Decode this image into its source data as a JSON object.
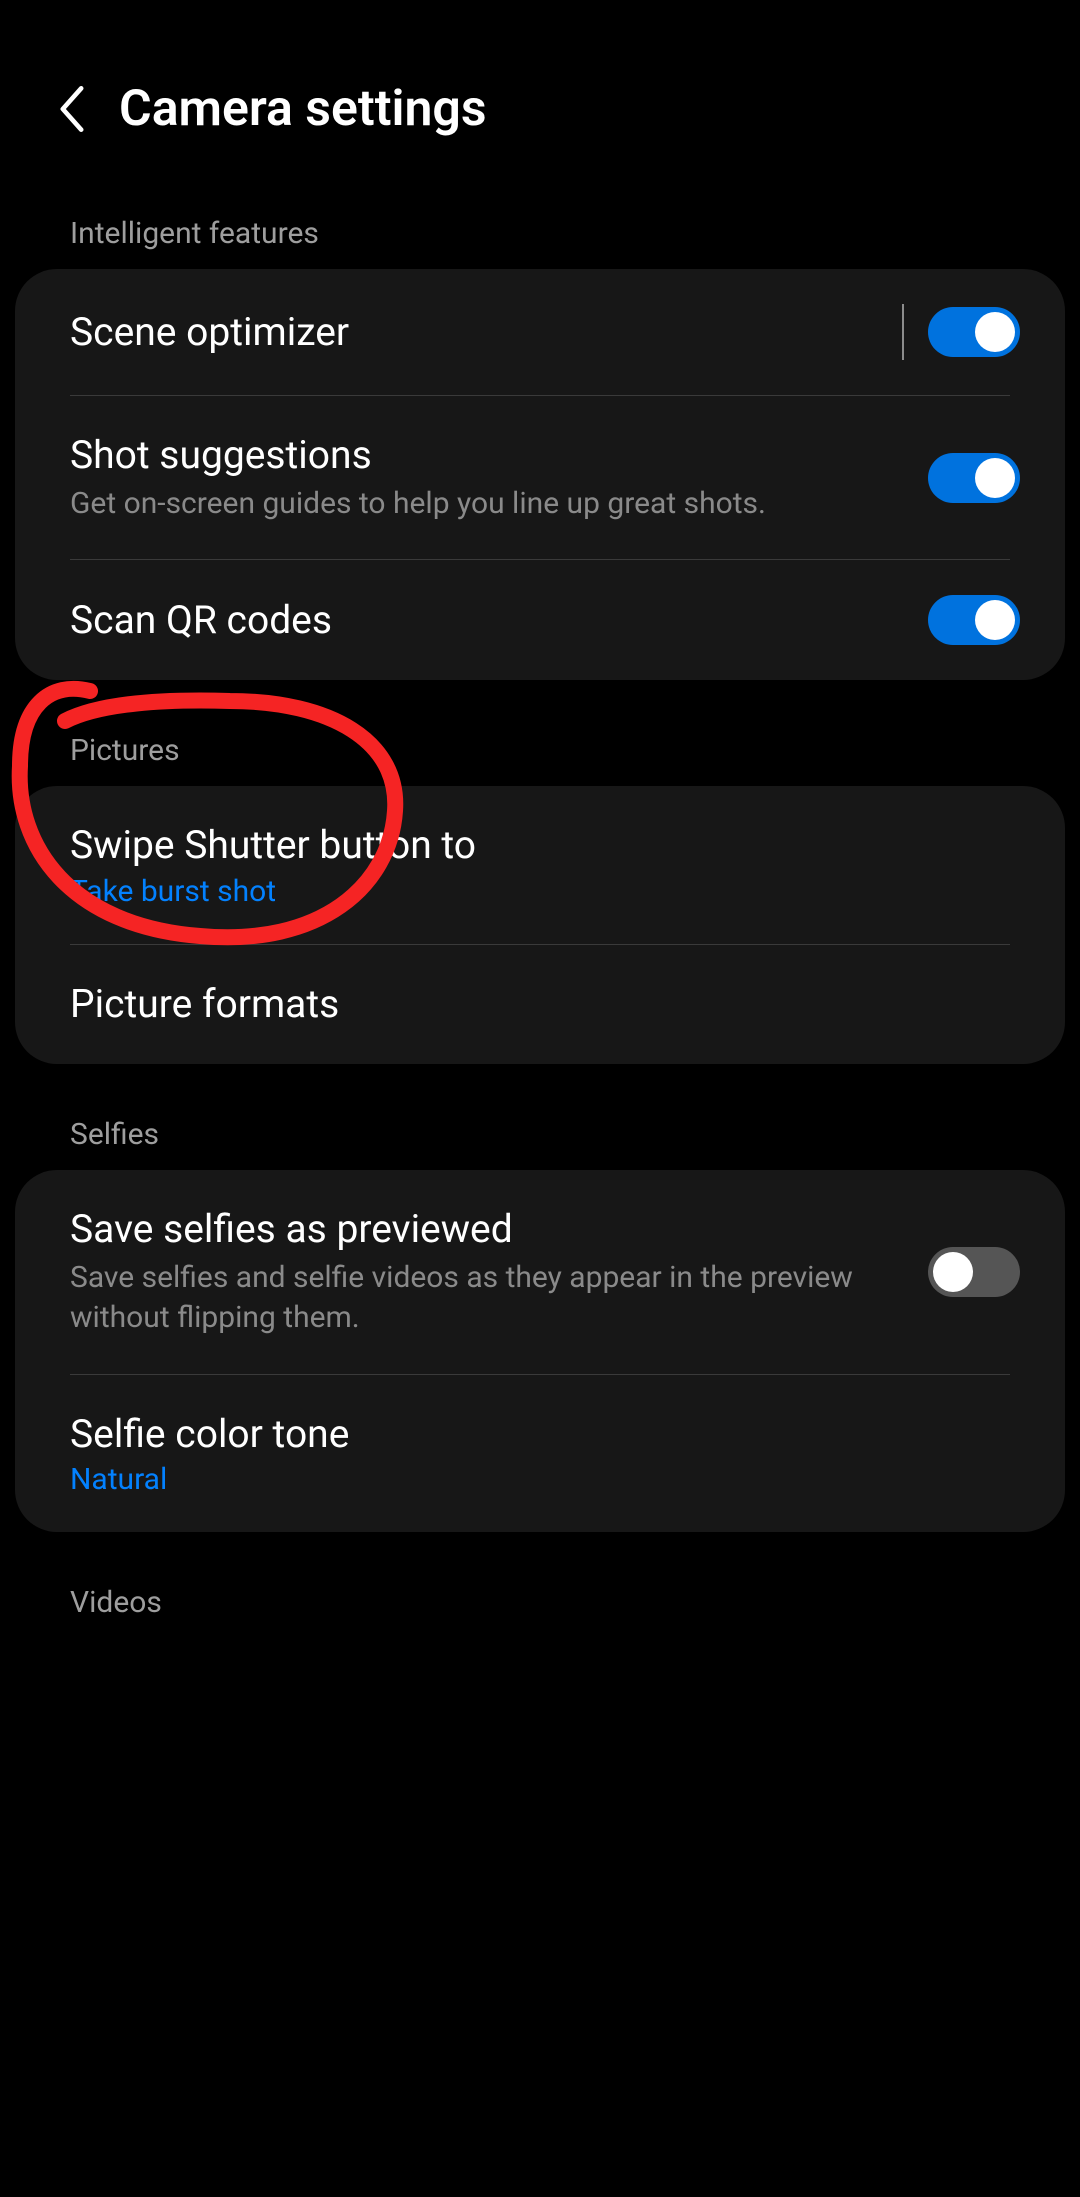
{
  "header": {
    "title": "Camera settings"
  },
  "sections": {
    "intelligent": {
      "label": "Intelligent features",
      "sceneOptimizer": {
        "title": "Scene optimizer",
        "on": true
      },
      "shotSuggestions": {
        "title": "Shot suggestions",
        "desc": "Get on-screen guides to help you line up great shots.",
        "on": true
      },
      "scanQr": {
        "title": "Scan QR codes",
        "on": true
      }
    },
    "pictures": {
      "label": "Pictures",
      "swipeShutter": {
        "title": "Swipe Shutter button to",
        "value": "Take burst shot"
      },
      "pictureFormats": {
        "title": "Picture formats"
      }
    },
    "selfies": {
      "label": "Selfies",
      "saveAsPreviewed": {
        "title": "Save selfies as previewed",
        "desc": "Save selfies and selfie videos as they appear in the preview without flipping them.",
        "on": false
      },
      "colorTone": {
        "title": "Selfie color tone",
        "value": "Natural"
      }
    },
    "videos": {
      "label": "Videos"
    }
  },
  "annotation": {
    "color": "#f52424"
  }
}
